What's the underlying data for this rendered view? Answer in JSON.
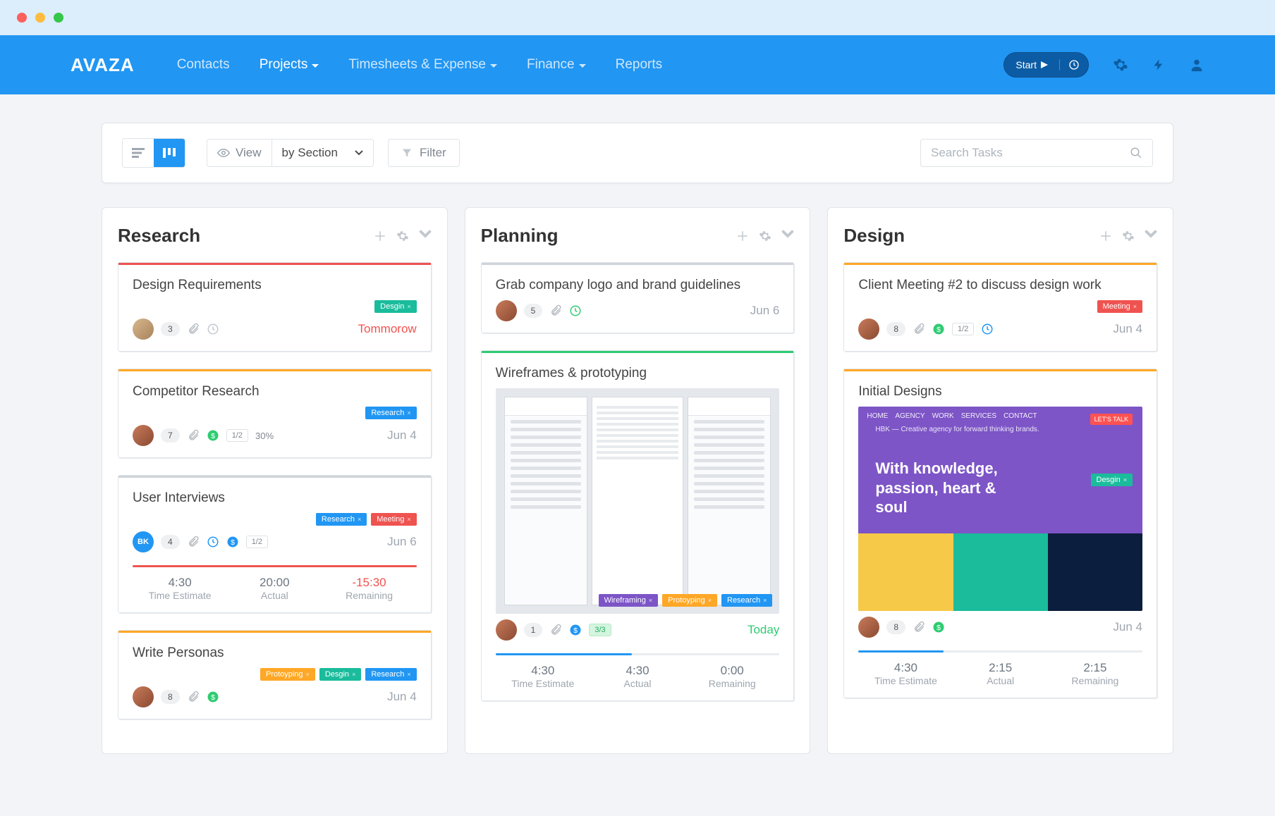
{
  "brand": "AVAZA",
  "nav": {
    "items": [
      "Contacts",
      "Projects",
      "Timesheets & Expense",
      "Finance",
      "Reports"
    ],
    "active": 1
  },
  "start_button": "Start",
  "toolbar": {
    "view_label": "View",
    "section_select": "by Section",
    "filter_label": "Filter",
    "search_placeholder": "Search Tasks"
  },
  "columns": [
    {
      "title": "Research",
      "cards": [
        {
          "strip": "red",
          "title": "Design Requirements",
          "tags": [
            {
              "label": "Desgin",
              "color": "teal"
            }
          ],
          "avatar": "",
          "avatar_type": "photo",
          "comments": "3",
          "icons": [
            "attach",
            "clock"
          ],
          "due": "Tommorow",
          "due_class": "tomorrow"
        },
        {
          "strip": "orange",
          "title": "Competitor Research",
          "tags": [
            {
              "label": "Research",
              "color": "blue"
            }
          ],
          "avatar": "",
          "avatar_type": "photo2",
          "comments": "7",
          "icons": [
            "attach",
            "dollar"
          ],
          "badge": "1/2",
          "pct": "30%",
          "due": "Jun 4"
        },
        {
          "strip": "gray",
          "title": "User Interviews",
          "tags": [
            {
              "label": "Research",
              "color": "blue"
            },
            {
              "label": "Meeting",
              "color": "red"
            }
          ],
          "avatar": "BK",
          "avatar_type": "bk",
          "comments": "4",
          "icons": [
            "attach",
            "clock-blue",
            "dollar-blue"
          ],
          "badge": "1/2",
          "due": "Jun 6",
          "timetrack": {
            "progress": 100,
            "progress_color": "red",
            "estimate": "4:30",
            "actual": "20:00",
            "remaining": "-15:30",
            "remaining_neg": true
          }
        },
        {
          "strip": "orange",
          "title": "Write Personas",
          "tags": [
            {
              "label": "Protoyping",
              "color": "orange"
            },
            {
              "label": "Desgin",
              "color": "teal"
            },
            {
              "label": "Research",
              "color": "blue"
            }
          ],
          "avatar": "",
          "avatar_type": "photo2",
          "comments": "8",
          "icons": [
            "attach",
            "dollar"
          ],
          "due": "Jun 4"
        }
      ]
    },
    {
      "title": "Planning",
      "cards": [
        {
          "strip": "gray",
          "title": "Grab company logo and brand guidelines",
          "avatar": "",
          "avatar_type": "photo2",
          "comments": "5",
          "icons": [
            "attach",
            "clock-green"
          ],
          "due": "Jun 6"
        },
        {
          "strip": "green",
          "title": "Wireframes & prototyping",
          "thumb": "wireframe",
          "thumb_tags": [
            {
              "label": "Wireframing",
              "color": "purple"
            },
            {
              "label": "Protoyping",
              "color": "orange"
            },
            {
              "label": "Research",
              "color": "blue"
            }
          ],
          "avatar": "",
          "avatar_type": "photo2",
          "comments": "1",
          "icons": [
            "attach",
            "dollar-blue"
          ],
          "badge": "3/3",
          "badge_green": true,
          "due": "Today",
          "due_class": "today",
          "timetrack": {
            "progress": 48,
            "estimate": "4:30",
            "actual": "4:30",
            "remaining": "0:00"
          }
        }
      ]
    },
    {
      "title": "Design",
      "cards": [
        {
          "strip": "orange",
          "title": "Client Meeting #2 to discuss design work",
          "tags": [
            {
              "label": "Meeting",
              "color": "red"
            }
          ],
          "avatar": "",
          "avatar_type": "photo2",
          "comments": "8",
          "icons": [
            "attach",
            "dollar"
          ],
          "badge": "1/2",
          "icons_extra": [
            "clock-blue"
          ],
          "due": "Jun 4"
        },
        {
          "strip": "orange",
          "title": "Initial Designs",
          "thumb": "design",
          "thumb_headline": "With knowledge, passion, heart & soul",
          "thumb_tag": {
            "label": "Desgin",
            "color": "teal"
          },
          "avatar": "",
          "avatar_type": "photo2",
          "comments": "8",
          "icons": [
            "attach",
            "dollar"
          ],
          "due": "Jun 4",
          "timetrack": {
            "progress": 30,
            "estimate": "4:30",
            "actual": "2:15",
            "remaining": "2:15"
          }
        }
      ]
    }
  ],
  "tt_labels": {
    "estimate": "Time Estimate",
    "actual": "Actual",
    "remaining": "Remaining"
  }
}
